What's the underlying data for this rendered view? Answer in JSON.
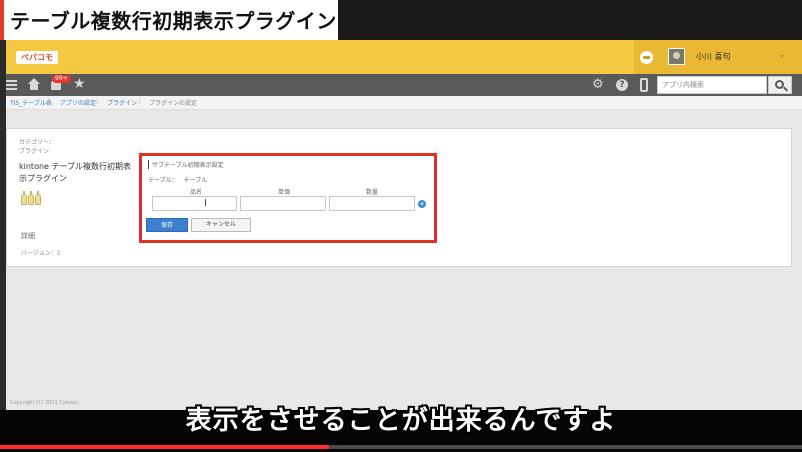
{
  "video": {
    "title_banner": "テーブル複数行初期表示プラグイン",
    "subtitle": "表示をさせることが出来るんですよ",
    "progress_fraction": 0.41
  },
  "header": {
    "logo_text": "ペパコモ",
    "user_name": "小川 喜句",
    "user_menu_icon": "chevron-down-icon"
  },
  "nav": {
    "badge": "99+",
    "icons": [
      "menu-icon",
      "home-icon",
      "bell-icon",
      "star-icon",
      "gear-icon",
      "help-icon",
      "mobile-icon",
      "search-icon"
    ],
    "search_placeholder": "アプリ内検索"
  },
  "breadcrumb": [
    "TIS_テーブル表",
    "アプリの設定",
    "プラグイン",
    "プラグインの設定"
  ],
  "plugin_info": {
    "category_label": "カテゴリー：",
    "category_value": "プラグイン",
    "name": "kintone テーブル複数行初期表示プラグイン",
    "details_label": "詳細",
    "version": "バージョン：1"
  },
  "settings": {
    "section_title": "サブテーブル初期表示設定",
    "table_label": "テーブル：",
    "table_value": "テーブル",
    "columns": [
      "品名",
      "単価",
      "数量"
    ],
    "save_label": "保存",
    "cancel_label": "キャンセル",
    "add_row_symbol": "+"
  },
  "footer": {
    "copyright": "Copyright (C) 2021 Cybozu"
  },
  "colors": {
    "header_yellow": "#f5c842",
    "nav_gray": "#5a5a5a",
    "highlight_red": "#e03224",
    "save_blue": "#3e7fcf",
    "progress_red": "#ff2d2d"
  }
}
